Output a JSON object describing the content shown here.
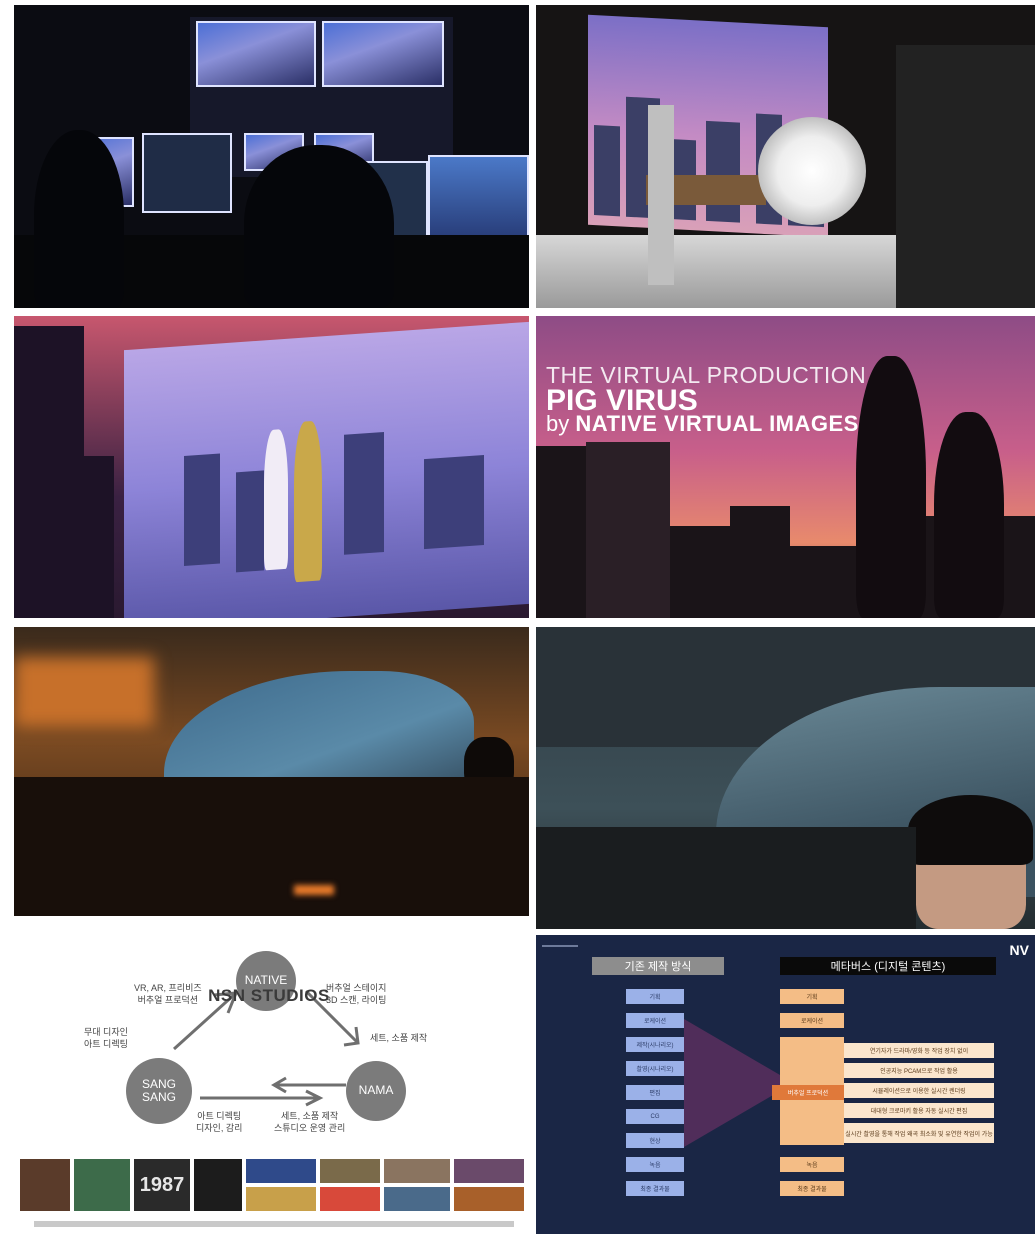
{
  "panels": {
    "control_room": {},
    "led_studio": {},
    "screen_scene": {},
    "title_card": {
      "line1": "THE VIRTUAL PRODUCTION OF",
      "line2": "PIG VIRUS",
      "by": "by",
      "company": "NATIVE VIRTUAL IMAGES"
    },
    "car_scene_left": {},
    "car_scene_right": {},
    "nsn_diagram": {
      "center": "NSN STUDIOS",
      "node_native": "NATIVE",
      "node_sang_line1": "SANG",
      "node_sang_line2": "SANG",
      "node_nama": "NAMA",
      "label_native_sang": "VR, AR, 프리비즈\n버추얼 프로덕션",
      "label_native_nama": "버추얼 스테이지\n3D 스캔, 라이팅",
      "label_sang_left": "무대 디자인\n아트 디렉팅",
      "label_nama_right": "세트, 소품 제작",
      "label_sang_nama": "아트 디렉팅\n디자인, 감리",
      "label_nama_sang": "세트, 소품 제작\n스튜디오 운영 관리",
      "poster_year": "1987"
    },
    "comparison": {
      "brand": "NV",
      "left_header": "기존 제작 방식",
      "right_header": "메타버스 (디지털 콘텐츠)",
      "left_steps": [
        "기획",
        "로케이션",
        "제작(시나리오)",
        "촬영(시나리오)",
        "편집",
        "CG",
        "현상",
        "녹음",
        "최종 결과물"
      ],
      "right_top": [
        "기획",
        "로케이션"
      ],
      "right_mid": "버추얼 프로덕션",
      "right_desc": [
        "연기자가 드라마/영화 등 작업 장치 없이",
        "인공지능 PCAM으로 작업 활용",
        "시뮬레이션으로 이용한 실시간 렌더링",
        "대대형 크로마키 활용 자동 실시간 편집",
        "실시간 촬영을 통해 작업 왜곡 최소화 및 유연한 작업이 가능"
      ],
      "right_bottom": [
        "녹음",
        "최종 결과물"
      ]
    }
  }
}
